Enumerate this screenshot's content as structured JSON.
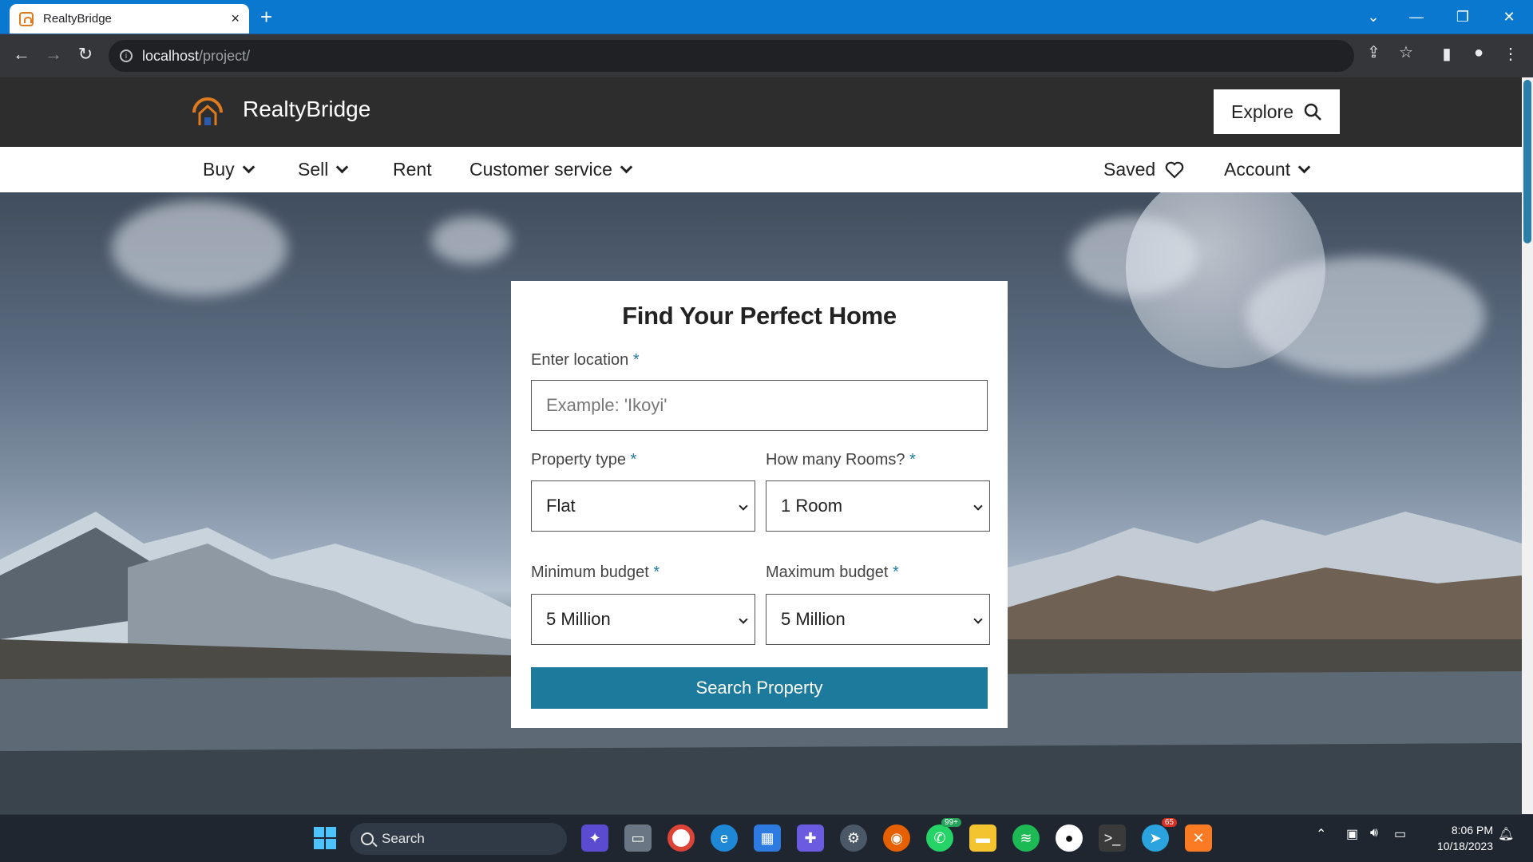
{
  "browser": {
    "tab_title": "RealtyBridge",
    "tab_close": "×",
    "new_tab": "+",
    "url_host": "localhost",
    "url_path": "/project/",
    "accent": "#0b78d0"
  },
  "site": {
    "brand": "RealtyBridge",
    "explore_label": "Explore",
    "nav": {
      "buy": "Buy",
      "sell": "Sell",
      "rent": "Rent",
      "customer_service": "Customer service",
      "saved": "Saved",
      "account": "Account"
    },
    "colors": {
      "header_bg": "#2d2d2d",
      "primary": "#1c7a9c",
      "logo": "#e07a1f"
    }
  },
  "form": {
    "title": "Find Your Perfect Home",
    "location_label": "Enter location",
    "location_placeholder": "Example: 'Ikoyi'",
    "property_type_label": "Property type",
    "property_type_value": "Flat",
    "rooms_label": "How many Rooms?",
    "rooms_value": "1 Room",
    "min_budget_label": "Minimum budget",
    "min_budget_value": "5 Million",
    "max_budget_label": "Maximum budget",
    "max_budget_value": "5 Million",
    "required_mark": "*",
    "submit_label": "Search Property"
  },
  "taskbar": {
    "search_label": "Search",
    "whatsapp_badge": "99+",
    "telegram_badge": "65",
    "time": "8:06 PM",
    "date": "10/18/2023"
  }
}
